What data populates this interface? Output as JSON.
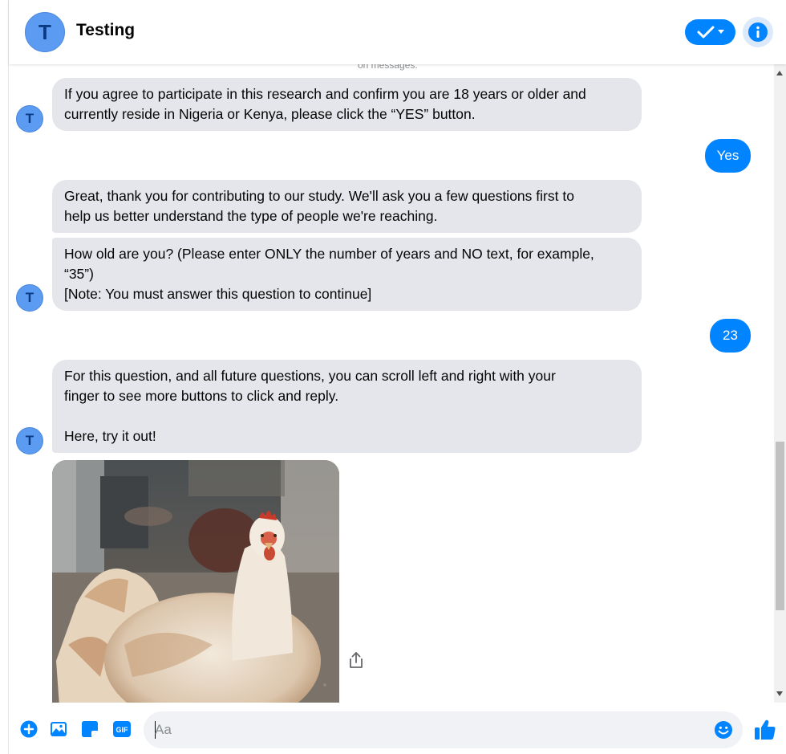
{
  "header": {
    "avatar_letter": "T",
    "title": "Testing"
  },
  "chat": {
    "faded_text": "on messages.",
    "messages": [
      {
        "sender": "bot",
        "text": "If you agree to participate in this research and confirm you are 18 years or older and\ncurrently reside in Nigeria or Kenya, please click the “YES” button."
      },
      {
        "sender": "user",
        "text": "Yes"
      },
      {
        "sender": "bot",
        "text": "Great, thank you for contributing to our study. We'll ask you a few questions first to\nhelp us better understand the type of people we're reaching."
      },
      {
        "sender": "bot",
        "text": "How old are you? (Please enter ONLY the number of years and NO text, for example,\n“35”)\n[Note: You must answer this question to continue]"
      },
      {
        "sender": "user",
        "text": "23"
      },
      {
        "sender": "bot",
        "text": "For this question, and all future questions, you can scroll left and right with your\nfinger to see more buttons to click and reply.\n\nHere, try it out!"
      }
    ],
    "avatar_letter": "T"
  },
  "composer": {
    "placeholder": "Aa",
    "value": ""
  },
  "colors": {
    "accent": "#0084ff",
    "bot_bubble": "#e4e6eb",
    "avatar": "#5b9bf2"
  }
}
